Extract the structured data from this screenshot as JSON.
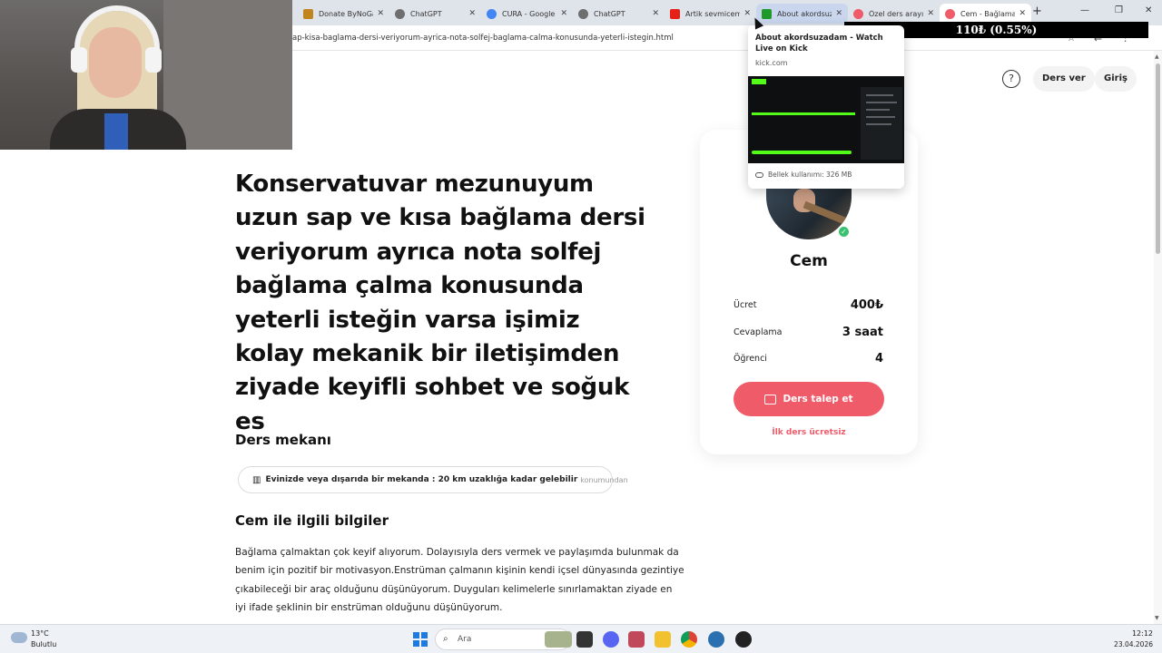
{
  "browser": {
    "tabs": [
      {
        "label": "Donate ByNoGame",
        "favicon_color": "#c0851e"
      },
      {
        "label": "ChatGPT",
        "favicon_color": "#6e6e6e"
      },
      {
        "label": "CURA - Google",
        "favicon_color": "#4285f4"
      },
      {
        "label": "ChatGPT",
        "favicon_color": "#6e6e6e"
      },
      {
        "label": "Artik sevmicem",
        "favicon_color": "#e62117"
      },
      {
        "label": "About akordsuz",
        "favicon_color": "#1f9a2a"
      },
      {
        "label": "Özel ders arayı",
        "favicon_color": "#f05b6a"
      },
      {
        "label": "Cem - Bağlama",
        "favicon_color": "#f05b6a"
      }
    ],
    "tab_close": "✕",
    "new_tab": "+",
    "window_controls": [
      "—",
      "❐",
      "✕"
    ],
    "url": "ap-kisa-baglama-dersi-veriyorum-ayrica-nota-solfej-baglama-calma-konusunda-yeterli-istegin.html",
    "price_ticker": "110₺ (0.55%)"
  },
  "tab_preview": {
    "title": "About akordsuzadam - Watch Live on Kick",
    "domain": "kick.com",
    "memory": "Bellek kullanımı: 326 MB"
  },
  "header": {
    "help": "?",
    "ders_ver": "Ders ver",
    "giris": "Giriş"
  },
  "main": {
    "title": "Konservatuvar mezunuyum uzun sap ve kısa bağlama dersi veriyorum ayrıca nota solfej bağlama çalma konusunda yeterli isteğin varsa işimiz kolay mekanik bir iletişimden ziyade keyifli sohbet ve soğuk es",
    "ders_mekani_title": "Ders mekanı",
    "location_main": "Evinizde veya dışarıda bir mekanda : 20 km uzaklığa kadar gelebilir",
    "location_muted": "konumundan",
    "about_title": "Cem ile ilgili bilgiler",
    "about_text": "Bağlama çalmaktan çok keyif alıyorum. Dolayısıyla ders vermek ve paylaşımda bulunmak da benim için pozitif bir motivasyon.Enstrüman çalmanın kişinin kendi içsel dünyasında gezintiye çıkabileceği bir araç olduğunu düşünüyorum. Duyguları kelimelerle sınırlamaktan ziyade en iyi ifade şeklinin bir enstrüman olduğunu düşünüyorum."
  },
  "card": {
    "name": "Cem",
    "verified": "✓",
    "stats": [
      {
        "label": "Ücret",
        "value": "400₺"
      },
      {
        "label": "Cevaplama",
        "value": "3 saat"
      },
      {
        "label": "Öğrenci",
        "value": "4"
      }
    ],
    "cta": "Ders talep et",
    "free": "İlk ders ücretsiz"
  },
  "taskbar": {
    "temp": "13°C",
    "weather": "Bulutlu",
    "search_placeholder": "Ara",
    "time": "12:12",
    "date": "23.04.2026",
    "accent": "#1f7ae0"
  },
  "colors": {
    "brand": "#f05b6a",
    "verified": "#39c070",
    "kick": "#53fc18"
  }
}
